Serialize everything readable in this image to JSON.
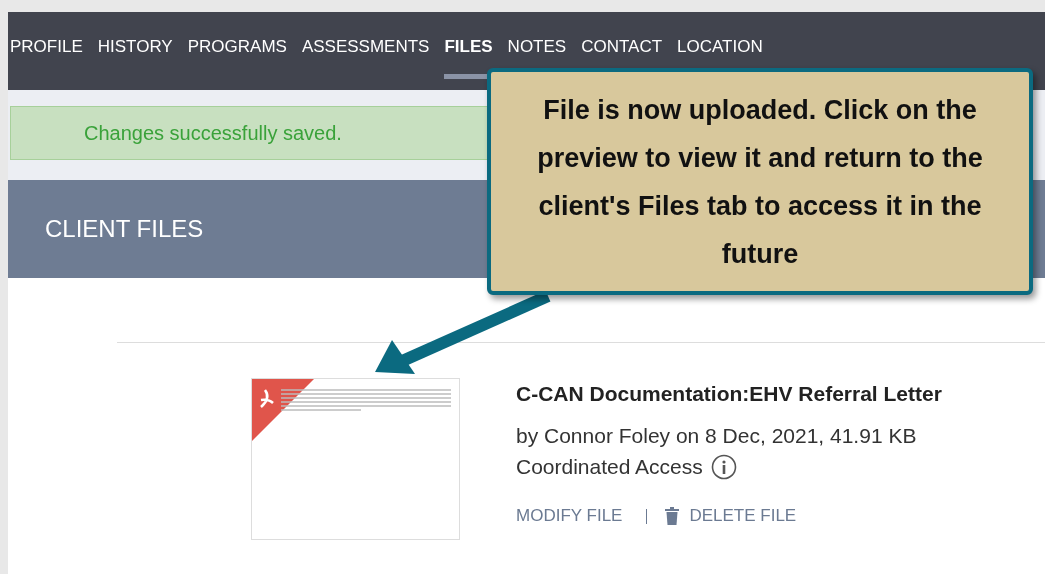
{
  "nav_tabs": [
    {
      "label": "PROFILE",
      "selected": false
    },
    {
      "label": "HISTORY",
      "selected": false
    },
    {
      "label": "PROGRAMS",
      "selected": false
    },
    {
      "label": "ASSESSMENTS",
      "selected": false
    },
    {
      "label": "FILES",
      "selected": true
    },
    {
      "label": "NOTES",
      "selected": false
    },
    {
      "label": "CONTACT",
      "selected": false
    },
    {
      "label": "LOCATION",
      "selected": false
    }
  ],
  "success_banner": "Changes successfully saved.",
  "section_title": "CLIENT FILES",
  "callout": "File is now uploaded. Click on the preview to view it and return to the client's Files tab to access it in the future",
  "file": {
    "title": "C-CAN Documentation:EHV Referral Letter",
    "meta": "by Connor Foley on 8 Dec, 2021, 41.91 KB",
    "category": "Coordinated Access",
    "actions": [
      {
        "label": "MODIFY FILE",
        "kind": "plain"
      },
      {
        "label": "DELETE FILE",
        "kind": "trash"
      }
    ]
  }
}
